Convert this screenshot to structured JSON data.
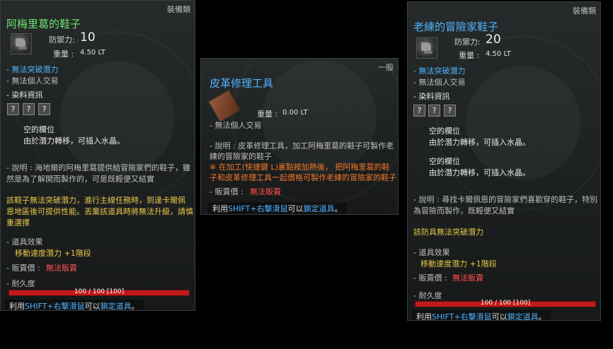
{
  "left": {
    "category": "裝備類",
    "title": "阿梅里葛的鞋子",
    "defense_label": "防禦力:",
    "defense_value": "10",
    "weight_label": "重量 :",
    "weight_value": "4.50 LT",
    "limit_break": "- 無法突破潛力",
    "personal_trade": "- 無法個人交易",
    "dye_info": "- 染料資訊",
    "dye_slots": [
      "?",
      "?",
      "?"
    ],
    "socket_title": "空的欄位",
    "socket_desc": "由於潛力轉移，可插入水晶。",
    "desc_line1": "- 說明 : 海地爾的阿梅里葛提供給冒險家們的鞋子，雖",
    "desc_line2": "然是為了解開而製作的，可是既輕便又結實",
    "notice_line1": "該鞋子無法突破潛力，進行主線任務時，到達卡爾佩",
    "notice_line2": "恩地區後可提供性能。丟棄該道具時將無法升級，請慎",
    "notice_line3": "重選擇",
    "effect_title": "- 道具效果",
    "effect_value": "移動速度潛力 +1階段",
    "sell_label": "- 販賣價 :",
    "sell_value": "無法販賣",
    "durability_label": "- 耐久度",
    "durability_text": "100 / 100 [100]",
    "durability_fraction": 1.0,
    "hint_pre": "利用",
    "hint_key": "SHIFT+右擊滑鼠",
    "hint_mid": "可以",
    "hint_lock": "鎖定道具",
    "hint_end": "。"
  },
  "middle": {
    "category": "一般",
    "title": "皮革修理工具",
    "weight_label": "重量 :",
    "weight_value": "0.00 LT",
    "personal_trade": "- 無法個人交易",
    "desc_line1": "- 說明 : 皮革修理工具，加工阿梅里葛的鞋子可製作老",
    "desc_line2": "練的冒險家的鞋子",
    "warn_line1": "※ 在加工(快捷鍵 L)裏點按加熱後， 把阿梅里葛的鞋",
    "warn_line2": "子和皮革修理工具一起價格可製作老練的冒險家的鞋子",
    "sell_label": "- 販賣價 :",
    "sell_value": "無法販賣",
    "hint_pre": "利用",
    "hint_key": "SHIFT+右擊滑鼠",
    "hint_mid": "可以",
    "hint_lock": "鎖定道具",
    "hint_end": "。"
  },
  "right": {
    "category": "裝備類",
    "title": "老練的冒險家鞋子",
    "defense_label": "防禦力:",
    "defense_value": "20",
    "weight_label": "重量 :",
    "weight_value": "4.50 LT",
    "limit_break": "- 無法突破潛力",
    "personal_trade": "- 無法個人交易",
    "dye_info": "- 染料資訊",
    "dye_slots": [
      "?",
      "?",
      "?"
    ],
    "socket1_title": "空的欄位",
    "socket1_desc": "由於潛力轉移，可插入水晶。",
    "socket2_title": "空的欄位",
    "socket2_desc": "由於潛力轉移，可插入水晶。",
    "desc_line1": "- 說明 : 尋找卡爾佩恩的冒險家們喜歡穿的鞋子，特別",
    "desc_line2": "為冒險而製作，既輕便又結實",
    "notice": "該防具無法突破潛力",
    "effect_title": "- 道具效果",
    "effect_value": "移動速度潛力 +1階段",
    "sell_label": "- 販賣價 :",
    "sell_value": "無法販賣",
    "durability_label": "- 耐久度",
    "durability_text": "100 / 100 [100]",
    "durability_fraction": 1.0,
    "hint_pre": "利用",
    "hint_key": "SHIFT+右擊滑鼠",
    "hint_mid": "可以",
    "hint_lock": "鎖定道具",
    "hint_end": "。"
  }
}
